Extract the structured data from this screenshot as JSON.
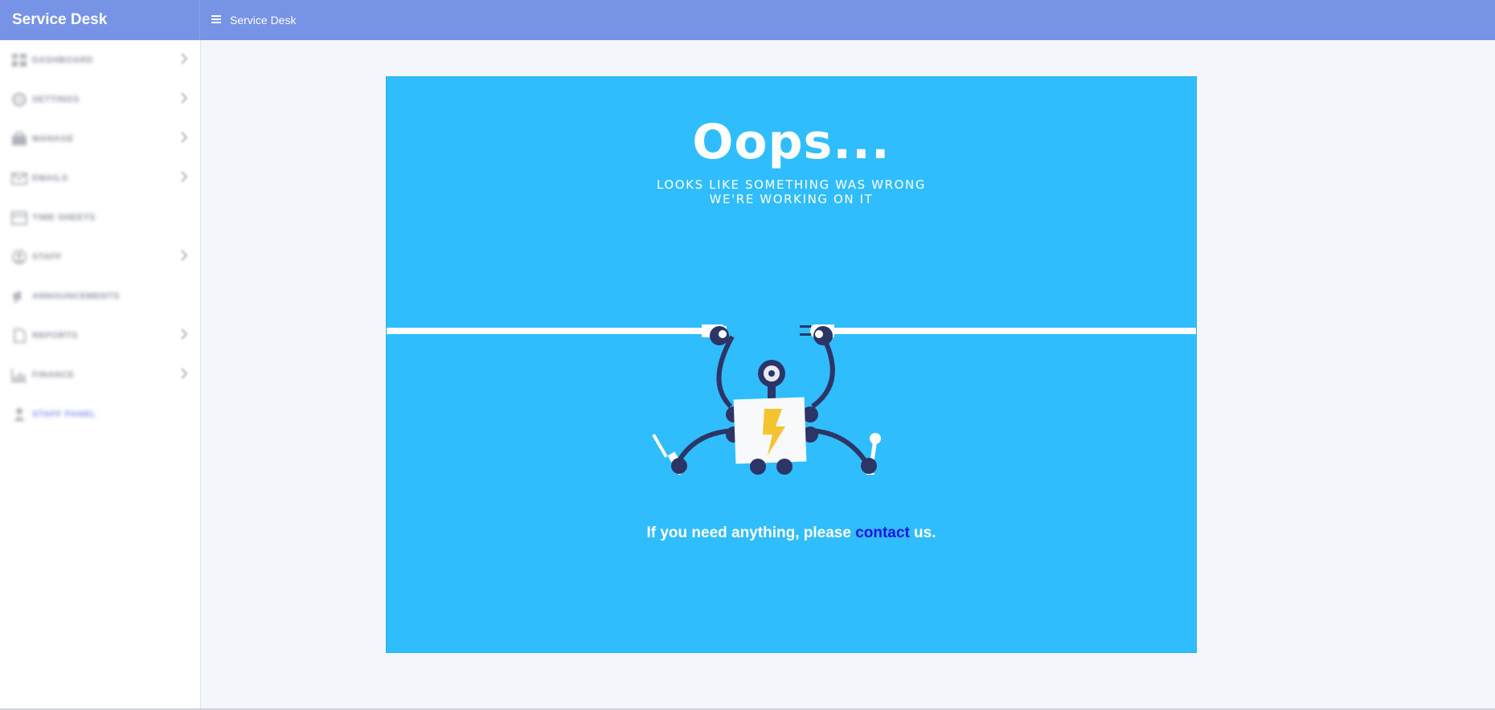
{
  "app": {
    "brand": "Service Desk",
    "page_title": "Service Desk"
  },
  "sidebar": {
    "items": [
      {
        "label": "DASHBOARD",
        "icon": "dashboard-icon",
        "chevron": true
      },
      {
        "label": "SETTINGS",
        "icon": "gear-icon",
        "chevron": true
      },
      {
        "label": "MANAGE",
        "icon": "briefcase-icon",
        "chevron": true
      },
      {
        "label": "EMAILS",
        "icon": "envelope-icon",
        "chevron": true
      },
      {
        "label": "TIME SHEETS",
        "icon": "calendar-icon",
        "chevron": false
      },
      {
        "label": "STAFF",
        "icon": "user-circle-icon",
        "chevron": true
      },
      {
        "label": "ANNOUNCEMENTS",
        "icon": "megaphone-icon",
        "chevron": false
      },
      {
        "label": "REPORTS",
        "icon": "document-icon",
        "chevron": true
      },
      {
        "label": "FINANCE",
        "icon": "chart-icon",
        "chevron": true
      },
      {
        "label": "STAFF PANEL",
        "icon": "user-icon",
        "chevron": false
      }
    ]
  },
  "error": {
    "title": "Oops...",
    "subtitle_line1": "LOOKS LIKE SOMETHING WAS WRONG",
    "subtitle_line2": "WE'RE WORKING ON IT",
    "message_before": "If you need anything, please ",
    "link_text": "contact",
    "message_after": " us."
  },
  "colors": {
    "topbar": "#7793e6",
    "card_background": "#30bdfd",
    "robot_body": "#2c3566",
    "bolt": "#f4c430",
    "link": "#1c15e3"
  }
}
